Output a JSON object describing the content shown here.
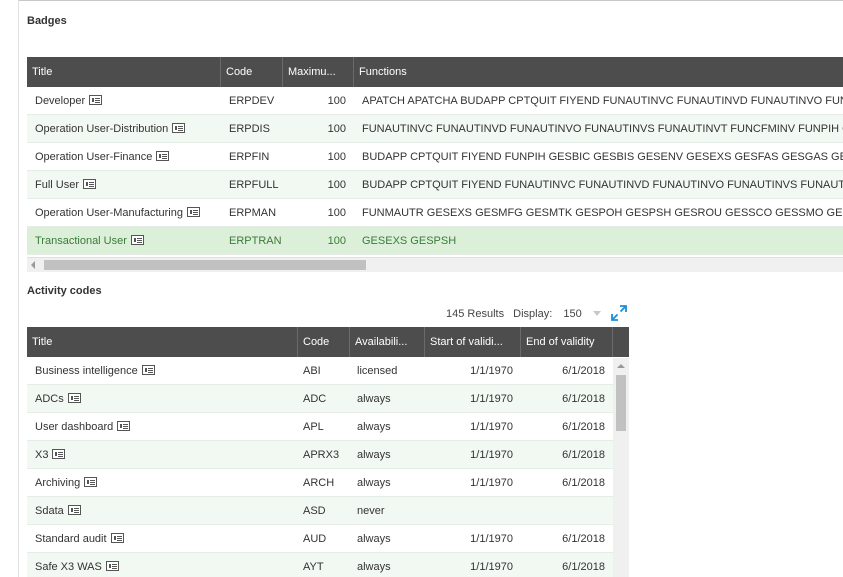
{
  "badges": {
    "title": "Badges",
    "columns": [
      "Title",
      "Code",
      "Maximu...",
      "Functions"
    ],
    "rows": [
      {
        "title": "Developer",
        "code": "ERPDEV",
        "max": "100",
        "functions": "APATCH APATCHA BUDAPP CPTQUIT FIYEND FUNAUTINVC FUNAUTINVD FUNAUTINVO FUNAUTINVS FUNAUTINVT"
      },
      {
        "title": "Operation User-Distribution",
        "code": "ERPDIS",
        "max": "100",
        "functions": "FUNAUTINVC FUNAUTINVD FUNAUTINVO FUNAUTINVS FUNAUTINVT FUNCFMINV FUNPIH GESBIC"
      },
      {
        "title": "Operation User-Finance",
        "code": "ERPFIN",
        "max": "100",
        "functions": "BUDAPP CPTQUIT FIYEND FUNPIH GESBIC GESBIS GESENV GESEXS GESFAS GESGAS GESLOF GESPOH"
      },
      {
        "title": "Full User",
        "code": "ERPFULL",
        "max": "100",
        "functions": "BUDAPP CPTQUIT FIYEND FUNAUTINVC FUNAUTINVD FUNAUTINVO FUNAUTINVS FUNAUTINVT FUNCFMINV"
      },
      {
        "title": "Operation User-Manufacturing",
        "code": "ERPMAN",
        "max": "100",
        "functions": "FUNMAUTR GESEXS GESMFG GESMTK GESPOH GESPSH GESROU GESSCO GESSMO GESSMR GESSRH"
      },
      {
        "title": "Transactional User",
        "code": "ERPTRAN",
        "max": "100",
        "functions": "GESEXS GESPSH"
      }
    ]
  },
  "activity": {
    "title": "Activity codes",
    "results": "145 Results",
    "display_label": "Display:",
    "display_value": "150",
    "columns": [
      "Title",
      "Code",
      "Availabili...",
      "Start of validi...",
      "End of validity"
    ],
    "rows": [
      {
        "title": "Business intelligence",
        "code": "ABI",
        "avail": "licensed",
        "start": "1/1/1970",
        "end": "6/1/2018"
      },
      {
        "title": "ADCs",
        "code": "ADC",
        "avail": "always",
        "start": "1/1/1970",
        "end": "6/1/2018"
      },
      {
        "title": "User dashboard",
        "code": "APL",
        "avail": "always",
        "start": "1/1/1970",
        "end": "6/1/2018"
      },
      {
        "title": "X3",
        "code": "APRX3",
        "avail": "always",
        "start": "1/1/1970",
        "end": "6/1/2018"
      },
      {
        "title": "Archiving",
        "code": "ARCH",
        "avail": "always",
        "start": "1/1/1970",
        "end": "6/1/2018"
      },
      {
        "title": "Sdata",
        "code": "ASD",
        "avail": "never",
        "start": "",
        "end": ""
      },
      {
        "title": "Standard audit",
        "code": "AUD",
        "avail": "always",
        "start": "1/1/1970",
        "end": "6/1/2018"
      },
      {
        "title": "Safe X3 WAS",
        "code": "AYT",
        "avail": "always",
        "start": "1/1/1970",
        "end": "6/1/2018"
      }
    ]
  },
  "icons": {
    "card": "card-icon",
    "expand": "expand-icon",
    "dropdown": "chevron-down-icon"
  },
  "colors": {
    "header_bg": "#4d4d4d",
    "selected_row": "#dcefd8",
    "alt_row": "#f2f8f2",
    "accent": "#1a8fd6"
  }
}
